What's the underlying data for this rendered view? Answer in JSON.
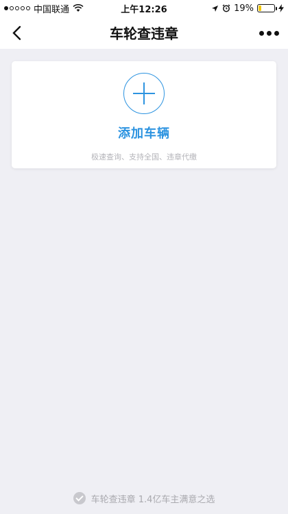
{
  "status_bar": {
    "carrier": "中国联通",
    "time": "上午12:26",
    "battery_percent": "19%",
    "battery_level": 0.19,
    "battery_color": "#f2c80f"
  },
  "nav": {
    "title": "车轮查违章",
    "back_icon": "chevron-left-icon",
    "more_icon": "more-dots-icon"
  },
  "card": {
    "title": "添加车辆",
    "subtitle": "极速查询、支持全国、违章代缴",
    "accent_color": "#2c93e0"
  },
  "footer": {
    "text": "车轮查违章 1.4亿车主满意之选"
  }
}
